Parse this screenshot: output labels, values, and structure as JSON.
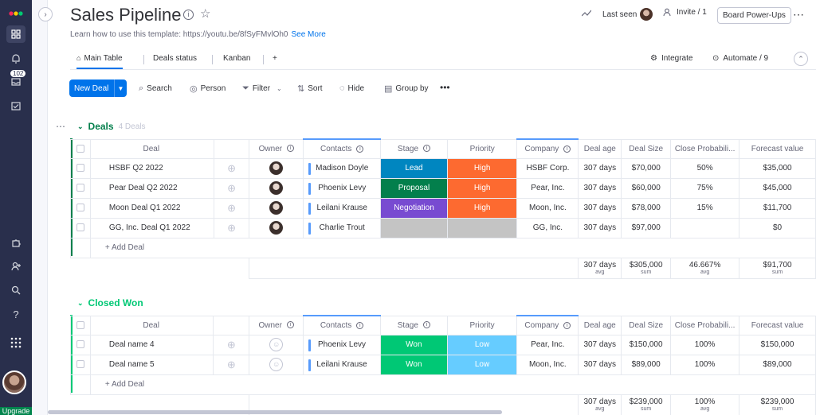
{
  "header": {
    "title": "Sales Pipeline",
    "subtitle_prefix": "Learn how to use this template: https://youtu.be/8fSyFMvlOh0",
    "see_more": "See More",
    "last_seen": "Last seen",
    "invite": "Invite / 1",
    "board_powerups": "Board Power-Ups",
    "more": "⋯"
  },
  "rail": {
    "badge": "102",
    "upgrade": "Upgrade",
    "icons": [
      "monday-logo-icon",
      "grid-icon",
      "bell-icon",
      "inbox-icon",
      "calendar-check-icon",
      "puzzle-icon",
      "add-user-icon",
      "search-icon",
      "help-icon",
      "apps-grid-icon"
    ]
  },
  "tabs": {
    "main_table": "Main Table",
    "deals_status": "Deals status",
    "kanban": "Kanban",
    "add": "+",
    "integrate": "Integrate",
    "automate": "Automate / 9"
  },
  "toolbar": {
    "new_deal": "New Deal",
    "search": "Search",
    "person": "Person",
    "filter": "Filter",
    "sort": "Sort",
    "hide": "Hide",
    "group_by": "Group by",
    "more": "•••"
  },
  "columns": {
    "deal": "Deal",
    "owner": "Owner",
    "contacts": "Contacts",
    "stage": "Stage",
    "priority": "Priority",
    "company": "Company",
    "deal_age": "Deal age",
    "deal_size": "Deal Size",
    "close_prob": "Close Probabili...",
    "forecast": "Forecast value"
  },
  "colors": {
    "deals_group": "#037f4c",
    "won_group": "#00c875",
    "lead": "#0086c0",
    "proposal": "#037f4c",
    "negotiation": "#784bd1",
    "won": "#00c875",
    "high": "#fd6a30",
    "low": "#66ccff",
    "empty": "#c4c4c4"
  },
  "groups": [
    {
      "title": "Deals",
      "count": "4 Deals",
      "rows": [
        {
          "deal": "HSBF Q2 2022",
          "owner": "avatar",
          "contact": "Madison Doyle",
          "stage": "Lead",
          "priority": "High",
          "company": "HSBF Corp.",
          "age": "307 days",
          "size": "$70,000",
          "prob": "50%",
          "forecast": "$35,000"
        },
        {
          "deal": "Pear Deal Q2 2022",
          "owner": "avatar",
          "contact": "Phoenix Levy",
          "stage": "Proposal",
          "priority": "High",
          "company": "Pear, Inc.",
          "age": "307 days",
          "size": "$60,000",
          "prob": "75%",
          "forecast": "$45,000"
        },
        {
          "deal": "Moon Deal Q1 2022",
          "owner": "avatar",
          "contact": "Leilani Krause",
          "stage": "Negotiation",
          "priority": "High",
          "company": "Moon, Inc.",
          "age": "307 days",
          "size": "$78,000",
          "prob": "15%",
          "forecast": "$11,700"
        },
        {
          "deal": "GG, Inc. Deal Q1 2022",
          "owner": "avatar",
          "contact": "Charlie Trout",
          "stage": "",
          "priority": "",
          "company": "GG, Inc.",
          "age": "307 days",
          "size": "$97,000",
          "prob": "",
          "forecast": "$0"
        }
      ],
      "add_label": "+ Add Deal",
      "summary": {
        "age": "307 days",
        "age_l": "avg",
        "size": "$305,000",
        "size_l": "sum",
        "prob": "46.667%",
        "prob_l": "avg",
        "forecast": "$91,700",
        "forecast_l": "sum"
      }
    },
    {
      "title": "Closed Won",
      "count": "",
      "rows": [
        {
          "deal": "Deal name 4",
          "owner": "empty",
          "contact": "Phoenix Levy",
          "stage": "Won",
          "priority": "Low",
          "company": "Pear, Inc.",
          "age": "307 days",
          "size": "$150,000",
          "prob": "100%",
          "forecast": "$150,000"
        },
        {
          "deal": "Deal name 5",
          "owner": "empty",
          "contact": "Leilani Krause",
          "stage": "Won",
          "priority": "Low",
          "company": "Moon, Inc.",
          "age": "307 days",
          "size": "$89,000",
          "prob": "100%",
          "forecast": "$89,000"
        }
      ],
      "add_label": "+ Add Deal",
      "summary": {
        "age": "307 days",
        "age_l": "avg",
        "size": "$239,000",
        "size_l": "sum",
        "prob": "100%",
        "prob_l": "avg",
        "forecast": "$239,000",
        "forecast_l": "sum"
      }
    }
  ]
}
